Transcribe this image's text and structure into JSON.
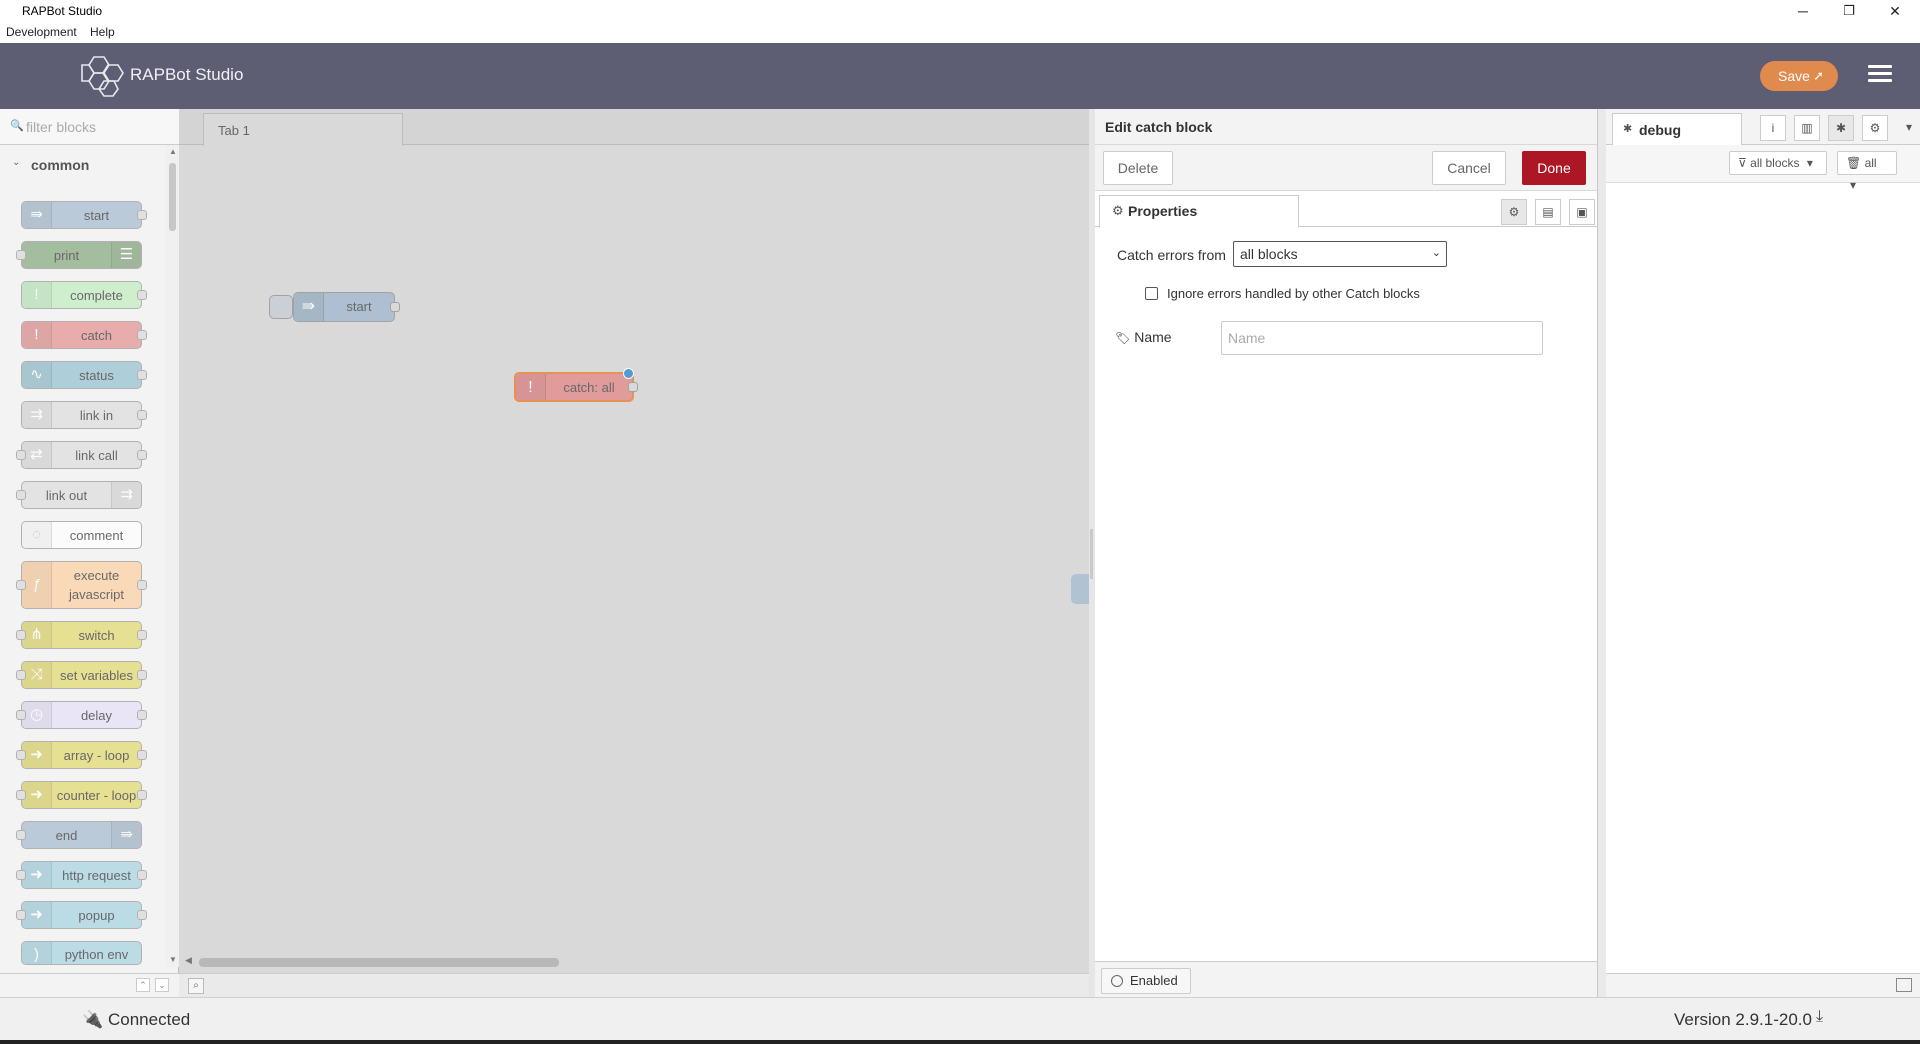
{
  "window": {
    "title": "RAPBot Studio",
    "minimize": "─",
    "restore": "❐",
    "close": "✕"
  },
  "menubar": [
    "Development",
    "Help"
  ],
  "header": {
    "brand": "RAPBot Studio",
    "save_label": "Save",
    "save_icon": "rocket-icon"
  },
  "palette": {
    "filter_placeholder": "filter blocks",
    "category": "common",
    "nodes": [
      {
        "label": "start",
        "color": "#a6bbcf"
      },
      {
        "label": "print",
        "color": "#87a980"
      },
      {
        "label": "complete",
        "color": "#c0edc0"
      },
      {
        "label": "catch",
        "color": "#e49191"
      },
      {
        "label": "status",
        "color": "#94c1d0"
      },
      {
        "label": "link in",
        "color": "#dddddd"
      },
      {
        "label": "link call",
        "color": "#dddddd"
      },
      {
        "label": "link out",
        "color": "#dddddd"
      },
      {
        "label": "comment",
        "color": "#ffffff"
      },
      {
        "label": "execute javascript",
        "color": "#fdd0a2"
      },
      {
        "label": "switch",
        "color": "#e2d96e"
      },
      {
        "label": "set variables",
        "color": "#e2d96e"
      },
      {
        "label": "delay",
        "color": "#e6e0f8"
      },
      {
        "label": "array - loop",
        "color": "#e2d96e"
      },
      {
        "label": "counter - loop",
        "color": "#e2d96e"
      },
      {
        "label": "end",
        "color": "#a6bbcf"
      },
      {
        "label": "http request",
        "color": "#a6d3e0"
      },
      {
        "label": "popup",
        "color": "#a6d3e0"
      },
      {
        "label": "python env",
        "color": "#a6d3e0"
      }
    ]
  },
  "workspace": {
    "tab": "Tab 1",
    "nodes": [
      {
        "label": "start",
        "color": "#a6bbcf"
      },
      {
        "label": "catch: all",
        "color": "#e49191"
      }
    ]
  },
  "editor": {
    "title": "Edit catch block",
    "delete_label": "Delete",
    "cancel_label": "Cancel",
    "done_label": "Done",
    "tab_label": "Properties",
    "catch_label": "Catch errors from",
    "catch_value": "all blocks",
    "ignore_label": "Ignore errors handled by other Catch blocks",
    "ignore_checked": false,
    "name_label": "Name",
    "name_placeholder": "Name",
    "enabled_label": "Enabled"
  },
  "sidebar": {
    "tab_label": "debug",
    "filter_label": "all blocks",
    "clear_label": "all"
  },
  "statusbar": {
    "connection": "Connected",
    "version": "Version 2.9.1-20.0"
  },
  "colors": {
    "header": "#5d5e73",
    "save": "#e08a4e",
    "done": "#ad1625"
  }
}
